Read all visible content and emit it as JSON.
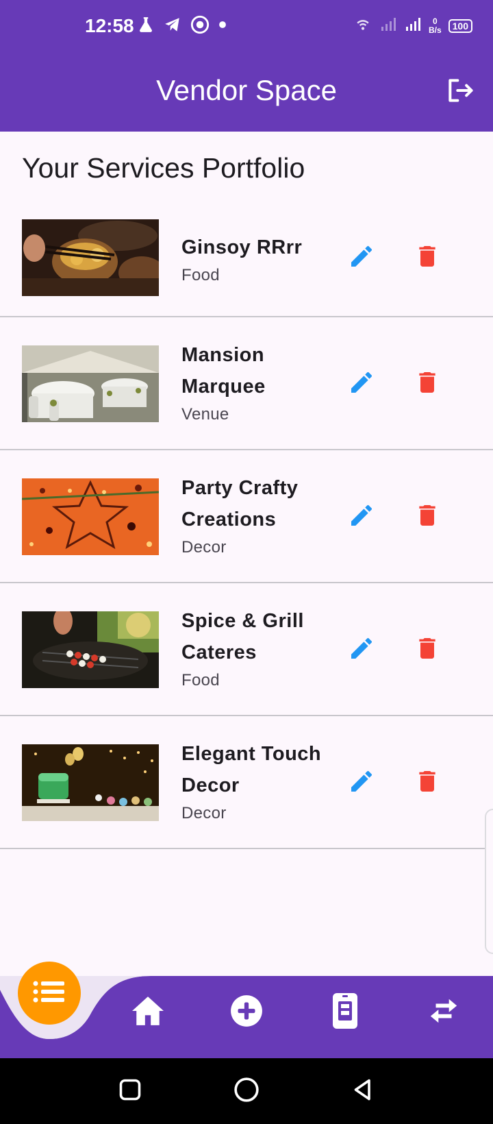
{
  "status_bar": {
    "time": "12:58",
    "network_speed_value": "0",
    "network_speed_unit": "B/s",
    "battery": "100"
  },
  "app_bar": {
    "title": "Vendor Space"
  },
  "page": {
    "heading": "Your Services Portfolio"
  },
  "services": [
    {
      "name": "Ginsoy RRrr",
      "category": "Food"
    },
    {
      "name": "Mansion Marquee",
      "category": "Venue"
    },
    {
      "name": "Party Crafty Creations",
      "category": "Decor"
    },
    {
      "name": "Spice & Grill Cateres",
      "category": "Food"
    },
    {
      "name": "Elegant Touch Decor",
      "category": "Decor"
    }
  ],
  "icons": {
    "logout": "logout-icon",
    "edit": "pencil-icon",
    "delete": "trash-icon",
    "list": "list-icon",
    "home": "home-icon",
    "add": "add-circle-icon",
    "bookings": "bookings-icon",
    "swap": "swap-icon"
  },
  "colors": {
    "primary": "#673ab7",
    "accent": "#ff9800",
    "edit": "#2196f3",
    "delete": "#f44336",
    "background": "#fdf7fd"
  }
}
